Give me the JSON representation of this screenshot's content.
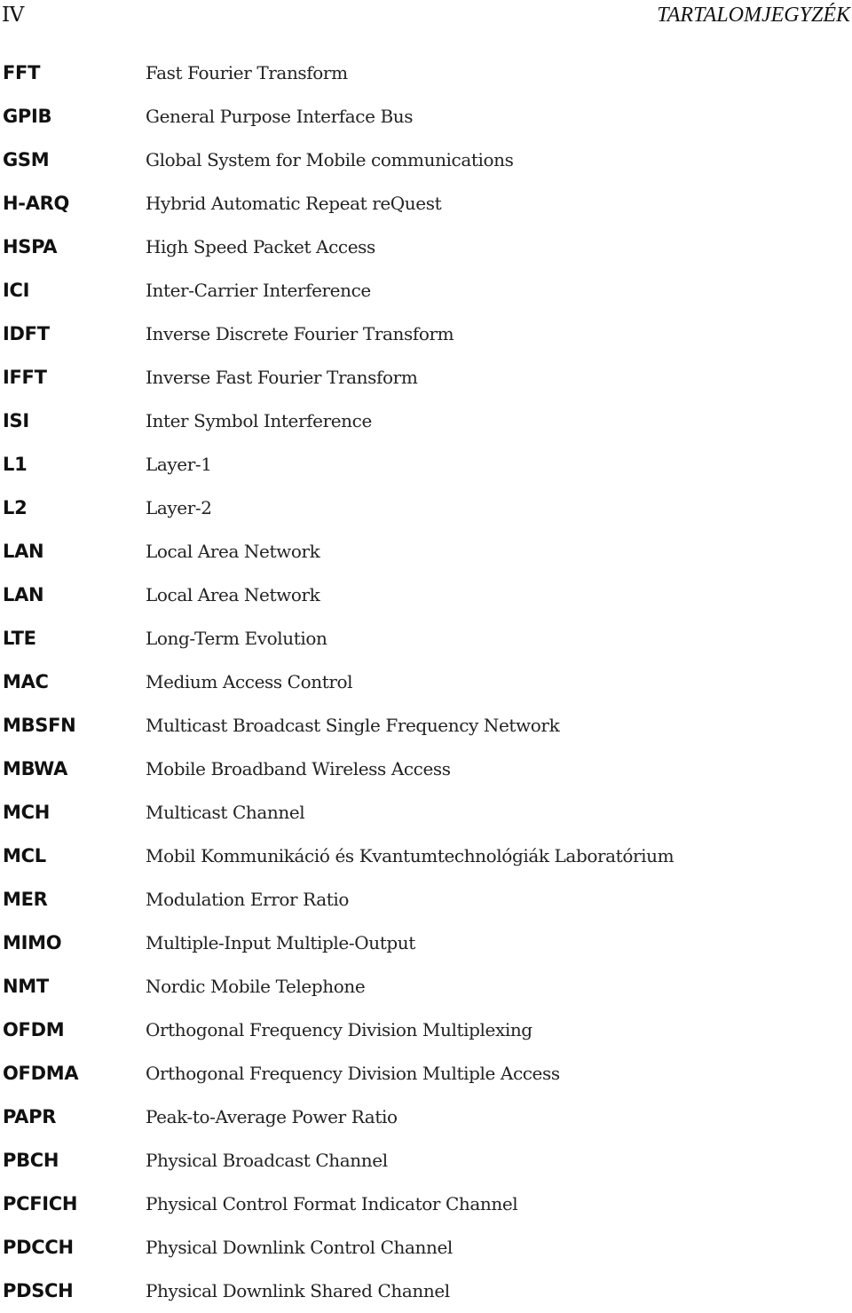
{
  "header": {
    "page_number": "IV",
    "chapter_title": "TARTALOMJEGYZÉK"
  },
  "abbreviations": [
    {
      "term": "FFT",
      "definition": "Fast Fourier Transform"
    },
    {
      "term": "GPIB",
      "definition": "General Purpose Interface Bus"
    },
    {
      "term": "GSM",
      "definition": "Global System for Mobile communications"
    },
    {
      "term": "H-ARQ",
      "definition": "Hybrid Automatic Repeat reQuest"
    },
    {
      "term": "HSPA",
      "definition": "High Speed Packet Access"
    },
    {
      "term": "ICI",
      "definition": "Inter-Carrier Interference"
    },
    {
      "term": "IDFT",
      "definition": "Inverse Discrete Fourier Transform"
    },
    {
      "term": "IFFT",
      "definition": "Inverse Fast Fourier Transform"
    },
    {
      "term": "ISI",
      "definition": "Inter Symbol Interference"
    },
    {
      "term": "L1",
      "definition": "Layer-1"
    },
    {
      "term": "L2",
      "definition": "Layer-2"
    },
    {
      "term": "LAN",
      "definition": "Local Area Network"
    },
    {
      "term": "LAN",
      "definition": "Local Area Network"
    },
    {
      "term": "LTE",
      "definition": "Long-Term Evolution"
    },
    {
      "term": "MAC",
      "definition": "Medium Access Control"
    },
    {
      "term": "MBSFN",
      "definition": "Multicast Broadcast Single Frequency Network"
    },
    {
      "term": "MBWA",
      "definition": "Mobile Broadband Wireless Access"
    },
    {
      "term": "MCH",
      "definition": "Multicast Channel"
    },
    {
      "term": "MCL",
      "definition": "Mobil Kommunikáció és Kvantumtechnológiák Laboratórium"
    },
    {
      "term": "MER",
      "definition": "Modulation Error Ratio"
    },
    {
      "term": "MIMO",
      "definition": "Multiple-Input Multiple-Output"
    },
    {
      "term": "NMT",
      "definition": "Nordic Mobile Telephone"
    },
    {
      "term": "OFDM",
      "definition": "Orthogonal Frequency Division Multiplexing"
    },
    {
      "term": "OFDMA",
      "definition": "Orthogonal Frequency Division Multiple Access"
    },
    {
      "term": "PAPR",
      "definition": "Peak-to-Average Power Ratio"
    },
    {
      "term": "PBCH",
      "definition": "Physical Broadcast Channel"
    },
    {
      "term": "PCFICH",
      "definition": "Physical Control Format Indicator Channel"
    },
    {
      "term": "PDCCH",
      "definition": "Physical Downlink Control Channel"
    },
    {
      "term": "PDSCH",
      "definition": "Physical Downlink Shared Channel"
    }
  ]
}
